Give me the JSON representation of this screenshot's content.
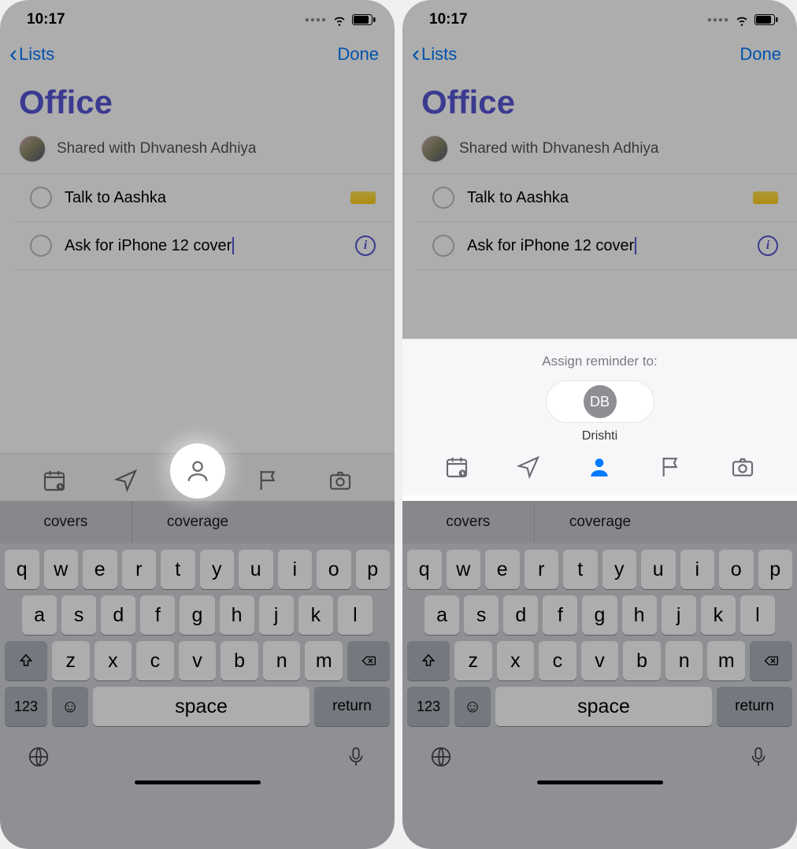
{
  "status": {
    "time": "10:17"
  },
  "nav": {
    "back": "Lists",
    "done": "Done"
  },
  "list": {
    "title": "Office",
    "shared_with": "Shared with Dhvanesh Adhiya",
    "items": [
      {
        "text": "Talk to Aashka"
      },
      {
        "text": "Ask for iPhone 12 cover"
      }
    ]
  },
  "assign": {
    "prompt": "Assign reminder to:",
    "initials": "DB",
    "name": "Drishti"
  },
  "keyboard": {
    "suggestions": [
      "covers",
      "coverage"
    ],
    "row1": [
      "q",
      "w",
      "e",
      "r",
      "t",
      "y",
      "u",
      "i",
      "o",
      "p"
    ],
    "row2": [
      "a",
      "s",
      "d",
      "f",
      "g",
      "h",
      "j",
      "k",
      "l"
    ],
    "row3": [
      "z",
      "x",
      "c",
      "v",
      "b",
      "n",
      "m"
    ],
    "numKey": "123",
    "space": "space",
    "return": "return"
  }
}
